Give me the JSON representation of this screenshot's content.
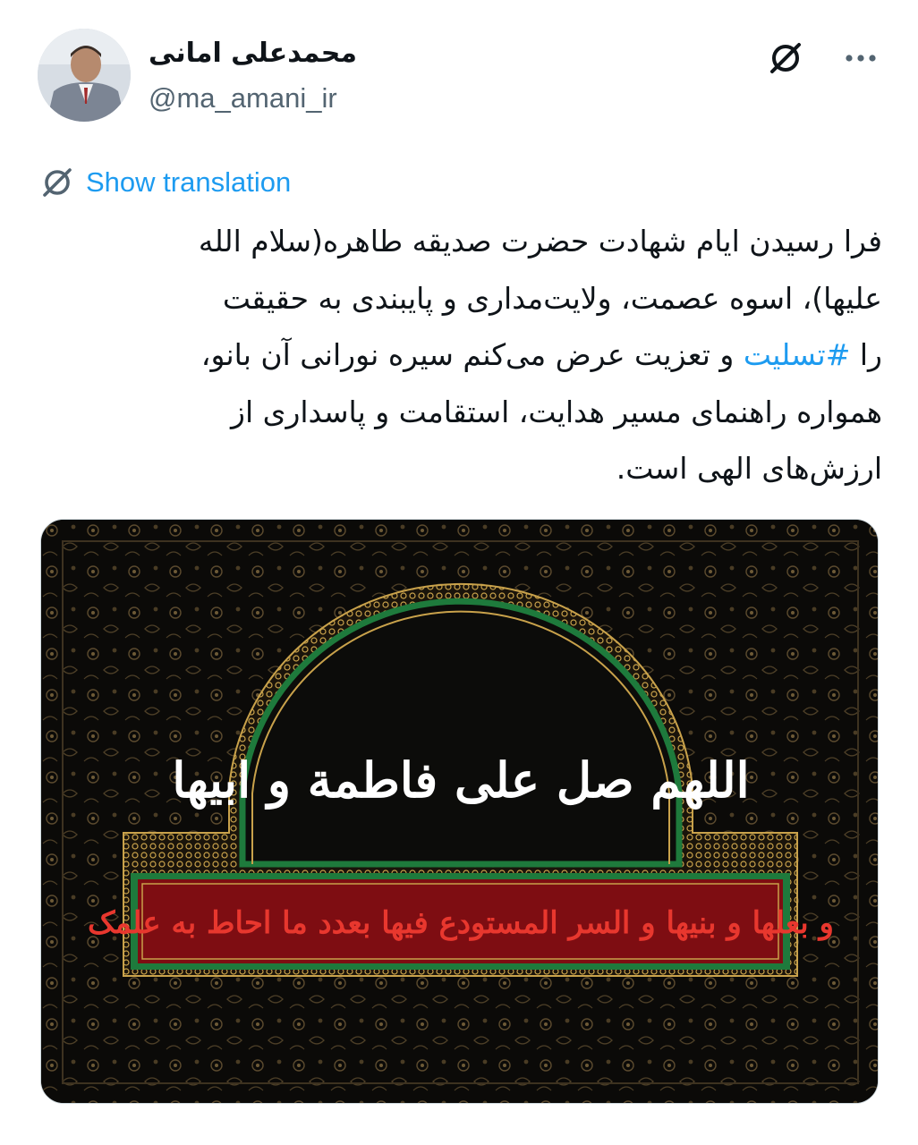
{
  "tweet": {
    "author": {
      "display_name": "محمدعلی امانی",
      "handle": "@ma_amani_ir"
    },
    "translate_label": "Show translation",
    "text_lines": [
      "فرا رسیدن ایام شهادت حضرت صدیقه طاهره(سلام الله",
      "علیها)، اسوه عصمت، ولایت‌مداری و پایبندی به حقیقت",
      "و تعزیت عرض می‌کنم سیره نورانی آن بانو،",
      "همواره راهنمای مسیر هدایت، استقامت و پاسداری از",
      "ارزش‌های الهی است."
    ],
    "line3_prefix": "را ",
    "hashtag": "#تسلیت",
    "line3_suffix": " و تعزیت عرض می‌کنم سیره نورانی آن بانو،",
    "media": {
      "arch_calligraphy": "اللهم صل علی فاطمة و ابیها",
      "band_calligraphy": "و بعلها و بنیها و السر المستودع فیها بعدد ما احاط به علمک"
    }
  },
  "icons": {
    "grok": "grok-icon",
    "more": "more-options-icon",
    "translate": "grok-icon"
  },
  "colors": {
    "link": "#1d9bf0",
    "secondary_text": "#536471",
    "primary_text": "#0f1419",
    "media_dark": "#0b0a08",
    "arch_green": "#1e7a3c",
    "band_red": "#7e0d12",
    "gold": "#c9a24b"
  }
}
